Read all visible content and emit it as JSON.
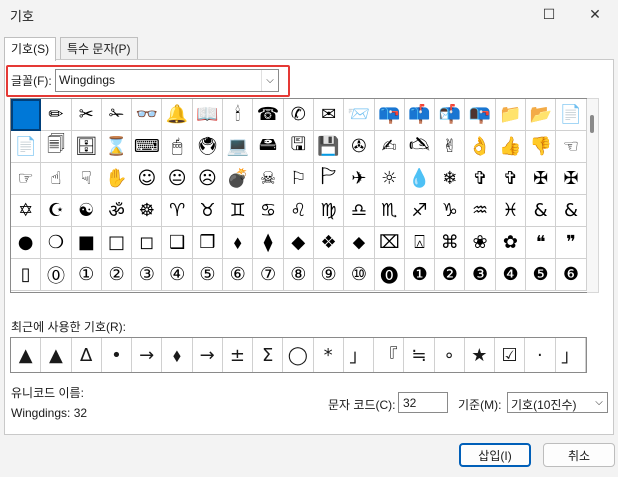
{
  "window": {
    "title": "기호",
    "maximize_glyph": "☐",
    "close_glyph": "✕"
  },
  "tabs": [
    {
      "label": "기호(S)"
    },
    {
      "label": "특수 문자(P)"
    }
  ],
  "font": {
    "label": "글꼴(F):",
    "value": "Wingdings"
  },
  "symbols": [
    "",
    "✏",
    "✂",
    "✁",
    "👓",
    "🔔",
    "📖",
    "🕯",
    "☎",
    "✆",
    "✉",
    "📨",
    "📪",
    "📫",
    "📬",
    "📭",
    "📁",
    "📂",
    "📄",
    "📄",
    "🗐",
    "🗄",
    "⌛",
    "⌨",
    "🖱",
    "🖲",
    "💻",
    "🖴",
    "🖫",
    "💾",
    "✇",
    "✍",
    "🖎",
    "✌",
    "👌",
    "👍",
    "👎",
    "☜",
    "☞",
    "☝",
    "☟",
    "✋",
    "☺",
    "😐",
    "☹",
    "💣",
    "☠",
    "⚐",
    "🏱",
    "✈",
    "☼",
    "💧",
    "❄",
    "✞",
    "✞",
    "✠",
    "✠",
    "✡",
    "☪",
    "☯",
    "ॐ",
    "☸",
    "♈",
    "♉",
    "♊",
    "♋",
    "♌",
    "♍",
    "♎",
    "♏",
    "♐",
    "♑",
    "♒",
    "♓",
    "&",
    "&",
    "●",
    "❍",
    "■",
    "□",
    "◻",
    "❑",
    "❒",
    "⬧",
    "⧫",
    "◆",
    "❖",
    "⬥",
    "⌧",
    "⍓",
    "⌘",
    "❀",
    "✿",
    "❝",
    "❞",
    "▯",
    "⓪",
    "①",
    "②",
    "③",
    "④",
    "⑤",
    "⑥",
    "⑦",
    "⑧",
    "⑨",
    "⑩",
    "⓿",
    "❶",
    "❷",
    "❸",
    "❹",
    "❺",
    "❻"
  ],
  "recent": {
    "label": "최근에 사용한 기호(R):",
    "items": [
      "▲",
      "▲",
      "∆",
      "•",
      "→",
      "⬧",
      "→",
      "±",
      "Σ",
      "◯",
      "*",
      "」",
      "『",
      "≒",
      "∘",
      "★",
      "☑",
      "·",
      "」"
    ]
  },
  "unicode": {
    "label": "유니코드 이름:",
    "name": "Wingdings: 32"
  },
  "code": {
    "label": "문자 코드(C):",
    "value": "32"
  },
  "base": {
    "label": "기준(M):",
    "value": "기호(10진수)"
  },
  "buttons": {
    "insert": "삽입(I)",
    "cancel": "취소"
  }
}
